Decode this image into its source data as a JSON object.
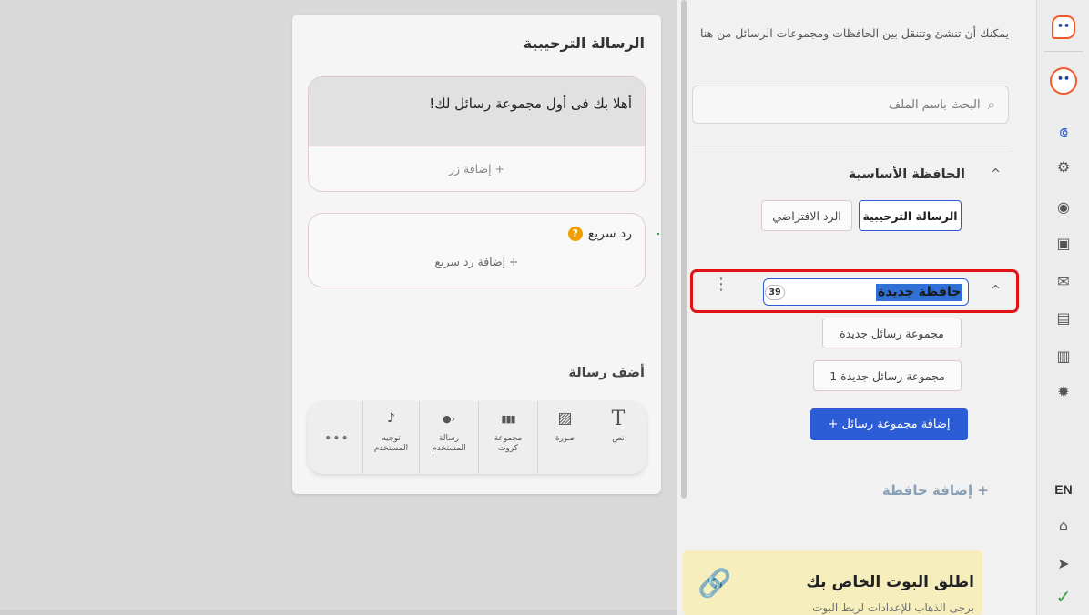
{
  "rail": {
    "language": "EN",
    "logo_glyph": "••",
    "icons": [
      "bot-logo-icon",
      "bot-logo-active-icon",
      "flow-icon",
      "brain-icon",
      "broadcast-icon",
      "contacts-icon",
      "mail-icon",
      "widgets-icon",
      "analytics-icon",
      "settings-icon",
      "language-toggle",
      "wallet-icon",
      "send-icon",
      "check-icon"
    ],
    "glyphs": {
      "flow": "⟃",
      "brain": "⚙",
      "broadcast": "◉",
      "contacts": "▣",
      "mail": "✉",
      "widgets": "▤",
      "analytics": "▥",
      "settings": "✹",
      "wallet": "⌂",
      "send": "➤",
      "check": "✓"
    }
  },
  "sidebar": {
    "hint": "يمكنك أن تنشئ وتتنقل بين الحافظات ومجموعات الرسائل من هنا",
    "search_placeholder": "البحث باسم الملف",
    "search_icon": "⌕",
    "chevron": "^",
    "kebab": "⋮",
    "main_folder": {
      "title": "الحافظة الأساسية",
      "items": [
        "الرسالة الترحيبية",
        "الرد الافتراضي"
      ],
      "active_item": "الرسالة الترحيبية"
    },
    "new_folder": {
      "name_value": "حافظة جديدة",
      "char_counter": "39",
      "groups": [
        "مجموعة رسائل جديدة",
        "مجموعة رسائل جديدة 1"
      ],
      "add_group_label": "إضافة مجموعة رسائل +"
    },
    "add_folder_label": "+ إضافة حافظة",
    "launch": {
      "title": "اطلق البوت الخاص بك",
      "subtitle": "برجى الذهاب للإعدادات لربط البوت",
      "icon": "🔗"
    }
  },
  "editor": {
    "title": "الرسالة الترحيبية",
    "message_text": "أهلا بك فى أول مجموعة رسائل لك!",
    "add_button_label": "+ إضافة زر",
    "quick_reply_title": "رد سريع",
    "quick_reply_help": "?",
    "add_quick_reply_label": "+ إضافة رد سريع",
    "add_message_label": "أضف رسالة",
    "palette": [
      {
        "name": "text",
        "label": "نص",
        "icon": "T"
      },
      {
        "name": "image",
        "label": "صورة",
        "icon": "▨"
      },
      {
        "name": "cards",
        "label": "مجموعة كروت",
        "icon": "▮▮▮"
      },
      {
        "name": "user-message",
        "label": "رسالة المستخدم",
        "icon": "●›"
      },
      {
        "name": "route-user",
        "label": "توجيه المستخدم",
        "icon": "♪"
      }
    ],
    "more_label": "•••"
  }
}
